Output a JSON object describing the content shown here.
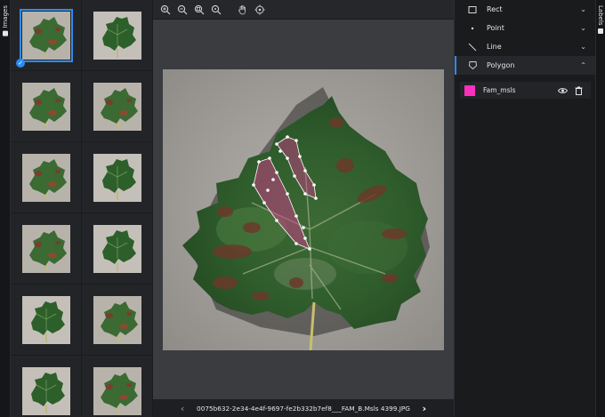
{
  "left_tab": {
    "label": "Images",
    "icon": "images-icon"
  },
  "right_tab": {
    "label": "Labels",
    "icon": "labels-icon"
  },
  "thumbnails": [
    {
      "leaf": "lesion",
      "selected": true
    },
    {
      "leaf": "green"
    },
    {
      "leaf": "lesion"
    },
    {
      "leaf": "lesion"
    },
    {
      "leaf": "lesion"
    },
    {
      "leaf": "green"
    },
    {
      "leaf": "lesion"
    },
    {
      "leaf": "green"
    },
    {
      "leaf": "green"
    },
    {
      "leaf": "lesion"
    },
    {
      "leaf": "green"
    },
    {
      "leaf": "lesion"
    }
  ],
  "toolbar": {
    "tools": [
      "zoom-in-icon",
      "zoom-out-icon",
      "zoom-fit-icon",
      "zoom-reset-icon",
      "pan-hand-icon",
      "crosshair-icon"
    ]
  },
  "bottom": {
    "prev_icon": "chevron-left-icon",
    "filename": "0075b632-2e34-4e4f-9697-fe2b332b7ef8___FAM_B.Msls 4399.JPG",
    "next_icon": "chevron-right-icon"
  },
  "label_tools": [
    {
      "label": "Rect",
      "icon": "rect-icon",
      "expanded": false
    },
    {
      "label": "Point",
      "icon": "point-icon",
      "expanded": false
    },
    {
      "label": "Line",
      "icon": "line-icon",
      "expanded": false
    },
    {
      "label": "Polygon",
      "icon": "polygon-icon",
      "expanded": true
    }
  ],
  "labels": [
    {
      "name": "Fam_msls",
      "color": "#ff2fbf"
    }
  ]
}
